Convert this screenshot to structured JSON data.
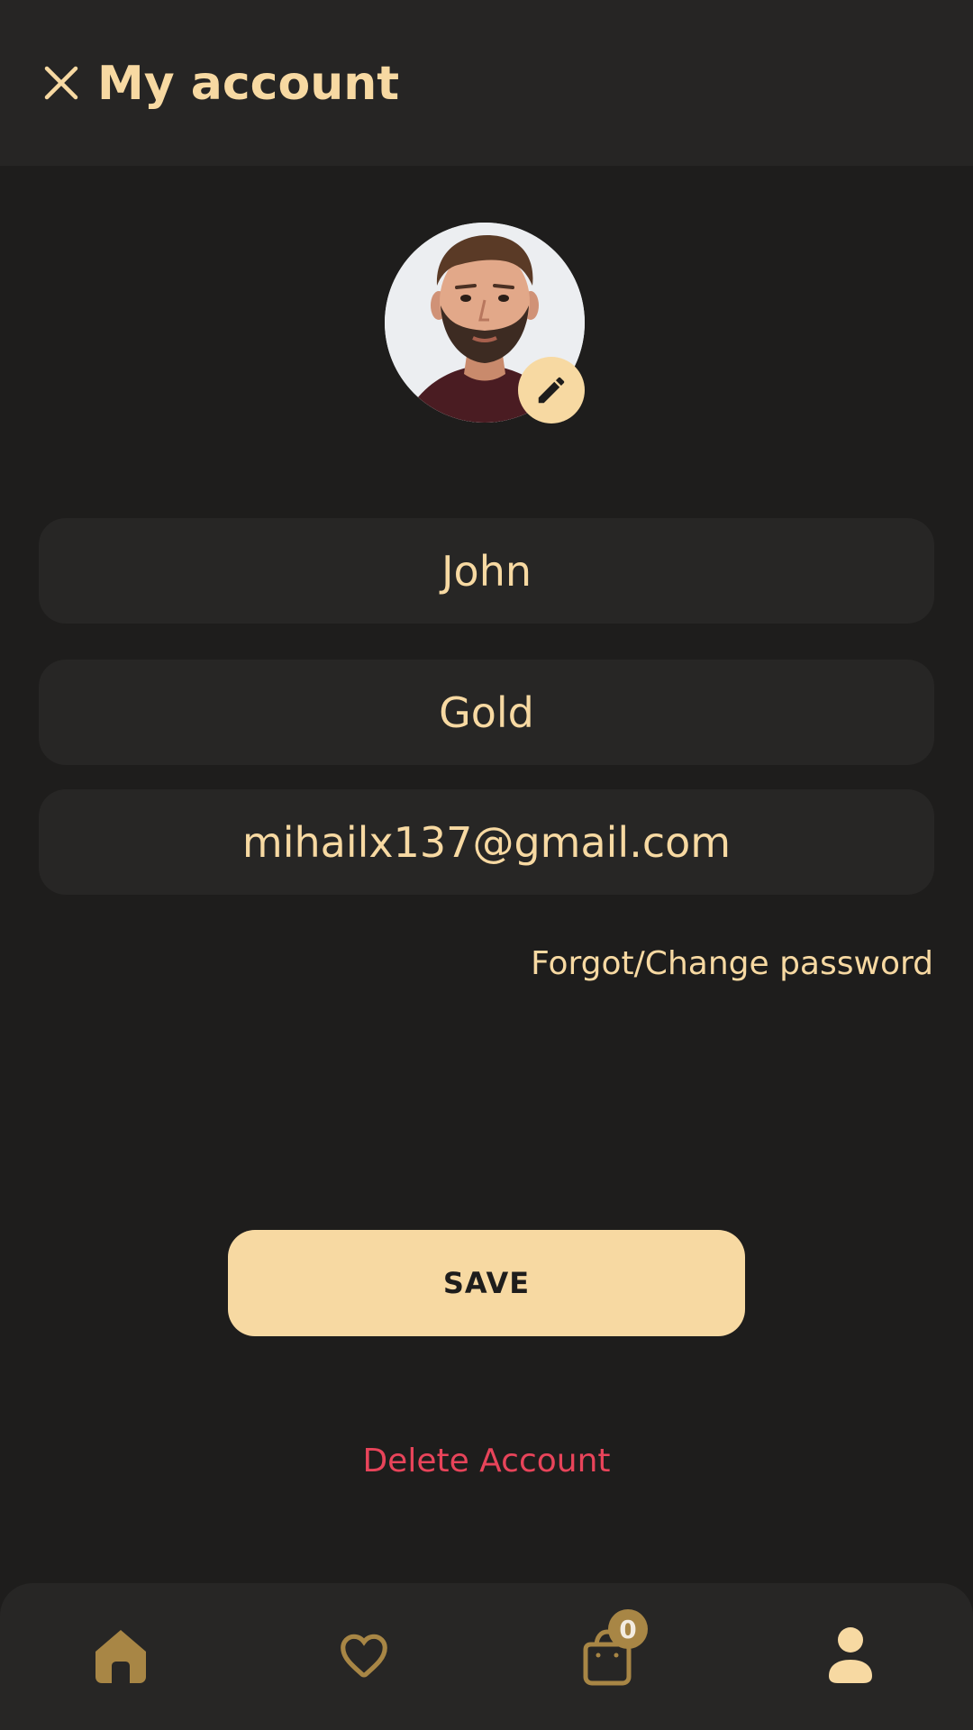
{
  "header": {
    "title": "My account",
    "close_icon": "close-icon"
  },
  "profile": {
    "avatar": "user-avatar-photo",
    "edit_icon": "pencil-icon"
  },
  "form": {
    "first_name": "John",
    "last_name": "Gold",
    "email": "mihailx137@gmail.com",
    "forgot_password_label": "Forgot/Change password"
  },
  "actions": {
    "save_label": "SAVE",
    "delete_label": "Delete Account"
  },
  "bottom_nav": {
    "items": [
      {
        "name": "home",
        "icon": "home-icon",
        "active": true
      },
      {
        "name": "favorites",
        "icon": "heart-icon",
        "active": false
      },
      {
        "name": "cart",
        "icon": "bag-icon",
        "active": false
      },
      {
        "name": "account",
        "icon": "user-icon",
        "active": false
      }
    ],
    "cart_count": "0"
  },
  "colors": {
    "background": "#1e1d1c",
    "surface": "#272625",
    "accent": "#f7d9a2",
    "accent_dark": "#a88645",
    "danger": "#e8445a"
  }
}
